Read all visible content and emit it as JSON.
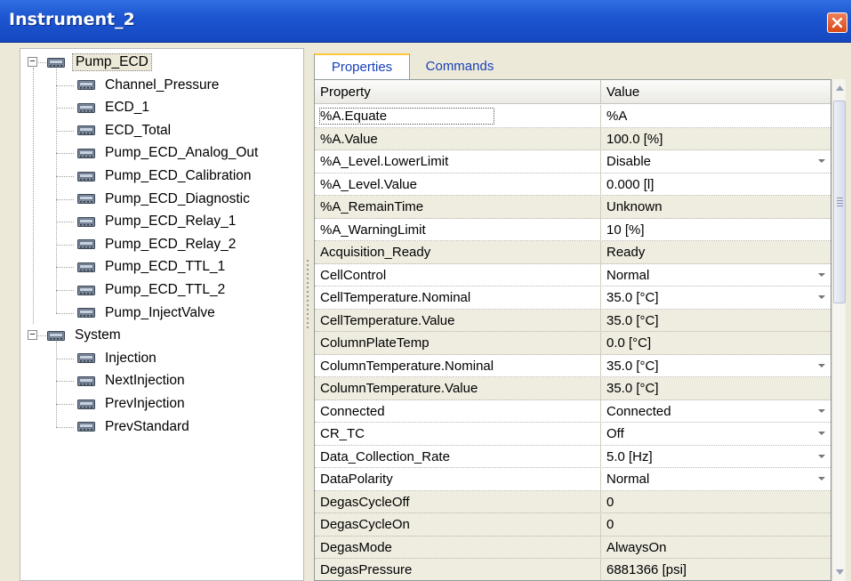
{
  "window": {
    "title": "Instrument_2"
  },
  "tree": {
    "groups": [
      {
        "label": "Pump_ECD",
        "expander": "−",
        "children": [
          "Channel_Pressure",
          "ECD_1",
          "ECD_Total",
          "Pump_ECD_Analog_Out",
          "Pump_ECD_Calibration",
          "Pump_ECD_Diagnostic",
          "Pump_ECD_Relay_1",
          "Pump_ECD_Relay_2",
          "Pump_ECD_TTL_1",
          "Pump_ECD_TTL_2",
          "Pump_InjectValve"
        ]
      },
      {
        "label": "System",
        "expander": "−",
        "children": [
          "Injection",
          "NextInjection",
          "PrevInjection",
          "PrevStandard"
        ]
      }
    ]
  },
  "tabs": [
    {
      "label": "Properties",
      "active": true
    },
    {
      "label": "Commands",
      "active": false
    }
  ],
  "grid": {
    "headers": {
      "property": "Property",
      "value": "Value"
    },
    "rows": [
      {
        "property": "%A.Equate",
        "value": "%A",
        "dropdown": false,
        "editable": true
      },
      {
        "property": "%A.Value",
        "value": "100.0 [%]",
        "dropdown": false,
        "editable": false
      },
      {
        "property": "%A_Level.LowerLimit",
        "value": "Disable",
        "dropdown": true,
        "editable": true
      },
      {
        "property": "%A_Level.Value",
        "value": "0.000 [l]",
        "dropdown": false,
        "editable": true
      },
      {
        "property": "%A_RemainTime",
        "value": "Unknown",
        "dropdown": false,
        "editable": false
      },
      {
        "property": "%A_WarningLimit",
        "value": "10 [%]",
        "dropdown": false,
        "editable": true
      },
      {
        "property": "Acquisition_Ready",
        "value": "Ready",
        "dropdown": false,
        "editable": false
      },
      {
        "property": "CellControl",
        "value": "Normal",
        "dropdown": true,
        "editable": true
      },
      {
        "property": "CellTemperature.Nominal",
        "value": "35.0 [°C]",
        "dropdown": true,
        "editable": true
      },
      {
        "property": "CellTemperature.Value",
        "value": "35.0 [°C]",
        "dropdown": false,
        "editable": false
      },
      {
        "property": "ColumnPlateTemp",
        "value": "0.0 [°C]",
        "dropdown": false,
        "editable": false
      },
      {
        "property": "ColumnTemperature.Nominal",
        "value": "35.0 [°C]",
        "dropdown": true,
        "editable": true
      },
      {
        "property": "ColumnTemperature.Value",
        "value": "35.0 [°C]",
        "dropdown": false,
        "editable": false
      },
      {
        "property": "Connected",
        "value": "Connected",
        "dropdown": true,
        "editable": true
      },
      {
        "property": "CR_TC",
        "value": "Off",
        "dropdown": true,
        "editable": true
      },
      {
        "property": "Data_Collection_Rate",
        "value": "5.0 [Hz]",
        "dropdown": true,
        "editable": true
      },
      {
        "property": "DataPolarity",
        "value": "Normal",
        "dropdown": true,
        "editable": true
      },
      {
        "property": "DegasCycleOff",
        "value": "0",
        "dropdown": false,
        "editable": false
      },
      {
        "property": "DegasCycleOn",
        "value": "0",
        "dropdown": false,
        "editable": false
      },
      {
        "property": "DegasMode",
        "value": "AlwaysOn",
        "dropdown": false,
        "editable": false
      },
      {
        "property": "DegasPressure",
        "value": "6881366 [psi]",
        "dropdown": false,
        "editable": false
      }
    ]
  },
  "colors": {
    "titlebar": "#1d56d2",
    "readonly_row": "#efece0",
    "tab_text": "#1840b8",
    "tab_highlight": "#ffc83c"
  }
}
